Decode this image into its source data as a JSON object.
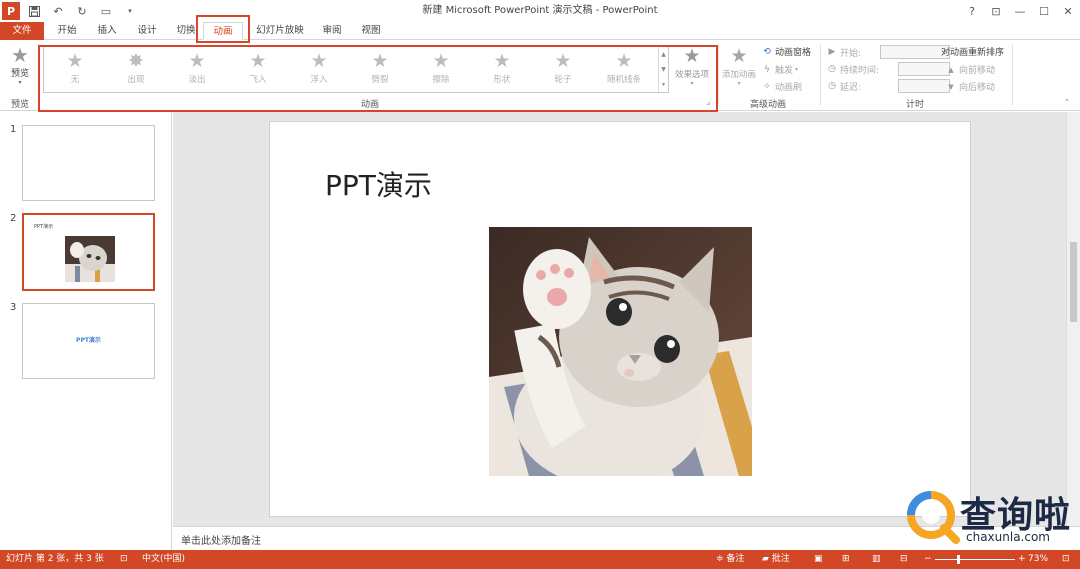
{
  "window": {
    "title": "新建 Microsoft PowerPoint 演示文稿 - PowerPoint",
    "controls": [
      "?",
      "⊡",
      "—",
      "☐",
      "✕"
    ]
  },
  "tabs": [
    {
      "label": "文件"
    },
    {
      "label": "开始"
    },
    {
      "label": "插入"
    },
    {
      "label": "设计"
    },
    {
      "label": "切换"
    },
    {
      "label": "动画"
    },
    {
      "label": "幻灯片放映"
    },
    {
      "label": "审阅"
    },
    {
      "label": "视图"
    }
  ],
  "active_tab": "动画",
  "ribbon": {
    "preview": {
      "label": "预览",
      "group": "预览"
    },
    "animations": [
      {
        "label": "无",
        "icon": "star-icon"
      },
      {
        "label": "出现",
        "icon": "burst-icon"
      },
      {
        "label": "淡出",
        "icon": "star-icon"
      },
      {
        "label": "飞入",
        "icon": "star-icon"
      },
      {
        "label": "浮入",
        "icon": "star-icon"
      },
      {
        "label": "劈裂",
        "icon": "star-icon"
      },
      {
        "label": "擦除",
        "icon": "star-icon"
      },
      {
        "label": "形状",
        "icon": "star-icon"
      },
      {
        "label": "轮子",
        "icon": "star-icon"
      },
      {
        "label": "随机线条",
        "icon": "star-icon"
      }
    ],
    "effect_options": "效果选项",
    "animation_group": "动画",
    "advanced": {
      "add_animation": "添加动画",
      "animation_pane": "动画窗格",
      "trigger": "触发",
      "animation_painter": "动画刷",
      "group": "高级动画"
    },
    "timing": {
      "start": "开始:",
      "duration": "持续时间:",
      "delay": "延迟:",
      "reorder": "对动画重新排序",
      "move_earlier": "向前移动",
      "move_later": "向后移动",
      "group": "计时"
    }
  },
  "slides": [
    {
      "number": "1"
    },
    {
      "number": "2",
      "thumb_title": "PPT演示"
    },
    {
      "number": "3",
      "thumb_text": "PPT演示"
    }
  ],
  "slide": {
    "title": "PPT演示"
  },
  "notes_placeholder": "单击此处添加备注",
  "status": {
    "slide_info": "幻灯片 第 2 张，共 3 张",
    "language": "中文(中国)",
    "notes": "备注",
    "comments": "批注",
    "zoom": "73%"
  },
  "watermark": {
    "cn": "查询啦",
    "en": "chaxunla.com"
  },
  "colors": {
    "accent": "#d24726",
    "highlight": "#d9442c"
  }
}
